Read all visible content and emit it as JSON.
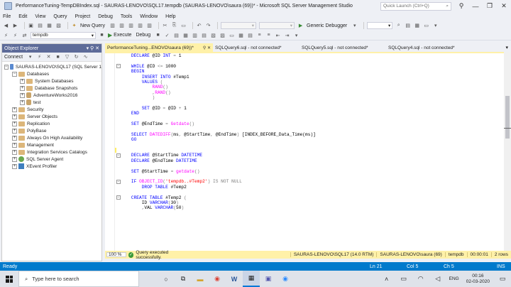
{
  "window": {
    "title": "PerformanceTuning-TempDBIndex.sql - SAURAS-LENOVO\\SQL17.tempdb (SAURAS-LENOVO\\saura (69))* - Microsoft SQL Server Management Studio",
    "quick_launch_placeholder": "Quick Launch (Ctrl+Q)"
  },
  "menu": [
    "File",
    "Edit",
    "View",
    "Query",
    "Project",
    "Debug",
    "Tools",
    "Window",
    "Help"
  ],
  "toolbar": {
    "new_query": "New Query",
    "generic_debugger": "Generic Debugger",
    "database": "tempdb",
    "execute": "Execute",
    "debug": "Debug"
  },
  "object_explorer": {
    "title": "Object Explorer",
    "connect": "Connect",
    "tree": [
      {
        "label": "SAURAS-LENOVO\\SQL17 (SQL Server 1",
        "level": 0,
        "exp": "-",
        "icon": "server"
      },
      {
        "label": "Databases",
        "level": 1,
        "exp": "-",
        "icon": "folder"
      },
      {
        "label": "System Databases",
        "level": 2,
        "exp": "+",
        "icon": "folder"
      },
      {
        "label": "Database Snapshots",
        "level": 2,
        "exp": "+",
        "icon": "folder"
      },
      {
        "label": "AdventureWorks2016",
        "level": 2,
        "exp": "+",
        "icon": "db"
      },
      {
        "label": "test",
        "level": 2,
        "exp": "+",
        "icon": "db"
      },
      {
        "label": "Security",
        "level": 1,
        "exp": "+",
        "icon": "folder"
      },
      {
        "label": "Server Objects",
        "level": 1,
        "exp": "+",
        "icon": "folder"
      },
      {
        "label": "Replication",
        "level": 1,
        "exp": "+",
        "icon": "folder"
      },
      {
        "label": "PolyBase",
        "level": 1,
        "exp": "+",
        "icon": "folder"
      },
      {
        "label": "Always On High Availability",
        "level": 1,
        "exp": "+",
        "icon": "folder"
      },
      {
        "label": "Management",
        "level": 1,
        "exp": "+",
        "icon": "folder"
      },
      {
        "label": "Integration Services Catalogs",
        "level": 1,
        "exp": "+",
        "icon": "folder"
      },
      {
        "label": "SQL Server Agent",
        "level": 1,
        "exp": "+",
        "icon": "agent"
      },
      {
        "label": "XEvent Profiler",
        "level": 1,
        "exp": "+",
        "icon": "xe"
      }
    ]
  },
  "tabs": [
    {
      "label": "PerformanceTuning...ENOVO\\saura (69))*",
      "active": true
    },
    {
      "label": "SQLQuery6.sql - not connected*",
      "active": false
    },
    {
      "label": "SQLQuery5.sql - not connected*",
      "active": false
    },
    {
      "label": "SQLQuery4.sql - not connected*",
      "active": false
    }
  ],
  "code_lines": [
    [
      [
        "kw",
        "    DECLARE "
      ],
      [
        "id",
        "@ID "
      ],
      [
        "kw",
        "INT "
      ],
      [
        "op",
        "= "
      ],
      [
        "id",
        "1"
      ]
    ],
    [],
    [
      [
        "kw",
        "    WHILE "
      ],
      [
        "id",
        "@ID "
      ],
      [
        "op",
        "<= "
      ],
      [
        "id",
        "1000"
      ]
    ],
    [
      [
        "kw",
        "    BEGIN"
      ]
    ],
    [
      [
        "kw",
        "        INSERT INTO "
      ],
      [
        "id",
        "#Temp1"
      ]
    ],
    [
      [
        "kw",
        "        VALUES "
      ],
      [
        "op",
        "("
      ]
    ],
    [
      [
        "fn",
        "            RAND"
      ],
      [
        "op",
        "()"
      ]
    ],
    [
      [
        "op",
        "            ,"
      ],
      [
        "fn",
        "RAND"
      ],
      [
        "op",
        "()"
      ]
    ],
    [
      [
        "op",
        "            )"
      ]
    ],
    [],
    [
      [
        "kw",
        "        SET "
      ],
      [
        "id",
        "@ID "
      ],
      [
        "op",
        "= "
      ],
      [
        "id",
        "@ID "
      ],
      [
        "op",
        "+ "
      ],
      [
        "id",
        "1"
      ]
    ],
    [
      [
        "kw",
        "    END"
      ]
    ],
    [],
    [
      [
        "kw",
        "    SET "
      ],
      [
        "id",
        "@EndTime "
      ],
      [
        "op",
        "= "
      ],
      [
        "fn",
        "Getdate"
      ],
      [
        "op",
        "()"
      ]
    ],
    [],
    [
      [
        "kw",
        "    SELECT "
      ],
      [
        "fn",
        "DATEDIFF"
      ],
      [
        "op",
        "("
      ],
      [
        "id",
        "ms"
      ],
      [
        "op",
        ", "
      ],
      [
        "id",
        "@StartTime"
      ],
      [
        "op",
        ", "
      ],
      [
        "id",
        "@EndTime"
      ],
      [
        "op",
        ") "
      ],
      [
        "id",
        "[INDEX_BEFORE_Data_Time(ms)]"
      ]
    ],
    [
      [
        "kw",
        "    GO"
      ]
    ],
    [],
    [],
    [
      [
        "kw",
        "    DECLARE "
      ],
      [
        "id",
        "@StartTime "
      ],
      [
        "kw",
        "DATETIME"
      ]
    ],
    [
      [
        "kw",
        "    DECLARE "
      ],
      [
        "id",
        "@EndTime "
      ],
      [
        "kw",
        "DATETIME"
      ]
    ],
    [],
    [
      [
        "kw",
        "    SET "
      ],
      [
        "id",
        "@StartTime "
      ],
      [
        "op",
        "= "
      ],
      [
        "fn",
        "getdate"
      ],
      [
        "op",
        "()"
      ]
    ],
    [],
    [
      [
        "kw",
        "    IF "
      ],
      [
        "fn",
        "OBJECT_ID"
      ],
      [
        "op",
        "("
      ],
      [
        "str",
        "'tempdb..#Temp2'"
      ],
      [
        "op",
        ") "
      ],
      [
        "op",
        "IS NOT NULL"
      ]
    ],
    [
      [
        "kw",
        "        DROP TABLE "
      ],
      [
        "id",
        "#Temp2"
      ]
    ],
    [],
    [
      [
        "kw",
        "    CREATE TABLE "
      ],
      [
        "id",
        "#Temp2 "
      ],
      [
        "op",
        "("
      ]
    ],
    [
      [
        "id",
        "        ID "
      ],
      [
        "kw",
        "VARCHAR"
      ],
      [
        "op",
        "("
      ],
      [
        "id",
        "30"
      ],
      [
        "op",
        ")"
      ]
    ],
    [
      [
        "op",
        "        ,"
      ],
      [
        "id",
        "VAL "
      ],
      [
        "kw",
        "VARCHAR"
      ],
      [
        "op",
        "("
      ],
      [
        "id",
        "50"
      ],
      [
        "op",
        ")"
      ]
    ]
  ],
  "editor": {
    "zoom": "100 %"
  },
  "query_status": {
    "message": "Query executed successfully.",
    "server": "SAURAS-LENOVO\\SQL17 (14.0 RTM)",
    "user": "SAURAS-LENOVO\\saura (69)",
    "database": "tempdb",
    "elapsed": "00:00:01",
    "rows": "2 rows"
  },
  "status_bar": {
    "ready": "Ready",
    "ln": "Ln 21",
    "col": "Col 5",
    "ch": "Ch 5",
    "ins": "INS"
  },
  "taskbar": {
    "search_placeholder": "Type here to search",
    "lang": "ENG",
    "time": "00:16",
    "date": "02-03-2020"
  },
  "colors": {
    "accent": "#007acc",
    "oe_header": "#5d6b99",
    "active_tab": "#fff1a8"
  }
}
